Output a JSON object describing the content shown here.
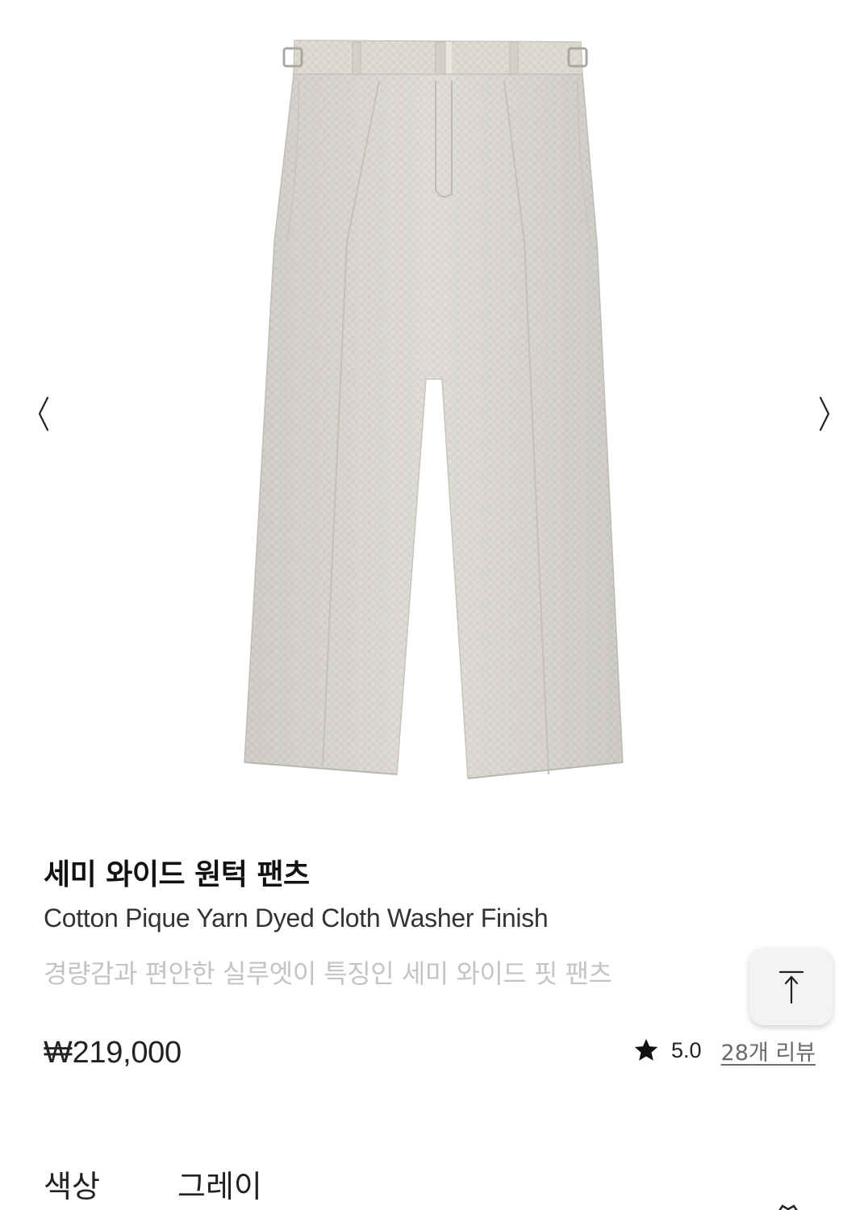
{
  "gallery": {
    "image_alt": "semi-wide pleated pants product photo",
    "prev_icon": "chevron-left-icon",
    "next_icon": "chevron-right-icon"
  },
  "product": {
    "title": "세미 와이드 원턱 팬츠",
    "subtitle": "Cotton Pique Yarn Dyed Cloth Washer Finish",
    "description": "경량감과 편안한 실루엣이 특징인 세미 와이드 핏 팬츠",
    "price": "₩219,000",
    "rating": "5.0",
    "reviews_label": "28개 리뷰"
  },
  "options": {
    "color_label": "색상",
    "color_value": "그레이"
  },
  "scroll_top": {
    "icon": "arrow-up-to-top-icon"
  },
  "colors": {
    "fabric": "#dcdad3",
    "text_primary": "#111111",
    "text_secondary": "#333333",
    "text_muted": "#c4c4c4"
  }
}
